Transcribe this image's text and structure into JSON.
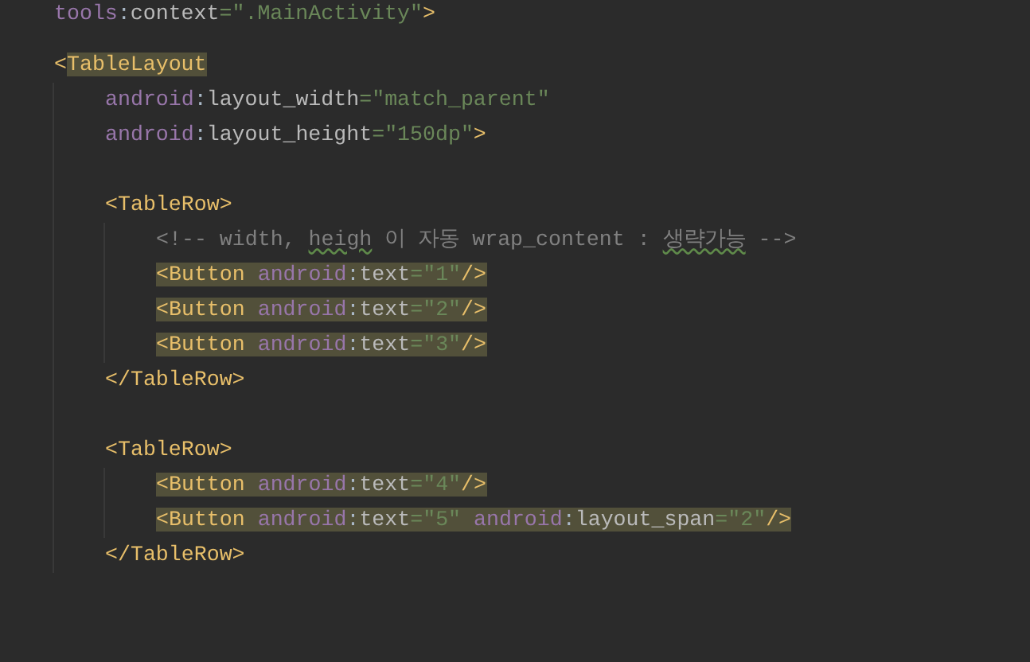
{
  "editor": {
    "lines": [
      {
        "kind": "code",
        "highlighted": false,
        "tokens": [
          {
            "kind": "ns",
            "text": "tools"
          },
          {
            "kind": "punct",
            "text": ":"
          },
          {
            "kind": "attr",
            "text": "context"
          },
          {
            "kind": "eq",
            "text": "="
          },
          {
            "kind": "string",
            "text": "\".MainActivity\""
          },
          {
            "kind": "tag",
            "text": ">"
          }
        ]
      },
      {
        "kind": "blank"
      },
      {
        "kind": "code",
        "highlighted": false,
        "tokens": [
          {
            "kind": "tag",
            "text": "<"
          },
          {
            "kind": "tag",
            "text": "TableLayout",
            "highlighted": true
          }
        ],
        "children": [
          {
            "kind": "code",
            "highlighted": false,
            "tokens": [
              {
                "kind": "ns",
                "text": "android"
              },
              {
                "kind": "punct",
                "text": ":"
              },
              {
                "kind": "attr",
                "text": "layout_width"
              },
              {
                "kind": "eq",
                "text": "="
              },
              {
                "kind": "string",
                "text": "\"match_parent\""
              }
            ]
          },
          {
            "kind": "code",
            "highlighted": false,
            "tokens": [
              {
                "kind": "ns",
                "text": "android"
              },
              {
                "kind": "punct",
                "text": ":"
              },
              {
                "kind": "attr",
                "text": "layout_height"
              },
              {
                "kind": "eq",
                "text": "="
              },
              {
                "kind": "string",
                "text": "\"150dp\""
              },
              {
                "kind": "tag",
                "text": ">"
              }
            ]
          },
          {
            "kind": "blank"
          },
          {
            "kind": "code",
            "highlighted": false,
            "tokens": [
              {
                "kind": "tag",
                "text": "<TableRow>"
              }
            ],
            "children": [
              {
                "kind": "code",
                "highlighted": false,
                "tokens": [
                  {
                    "kind": "comment",
                    "text": "<!-- width, "
                  },
                  {
                    "kind": "comment",
                    "text": "heigh",
                    "underlined": true
                  },
                  {
                    "kind": "comment",
                    "text": " 이 자동 wrap_content : "
                  },
                  {
                    "kind": "comment",
                    "text": "생략가능",
                    "underlined": true
                  },
                  {
                    "kind": "comment",
                    "text": " -->"
                  }
                ]
              },
              {
                "kind": "code",
                "highlighted": true,
                "tokens": [
                  {
                    "kind": "tag",
                    "text": "<Button "
                  },
                  {
                    "kind": "ns",
                    "text": "android"
                  },
                  {
                    "kind": "punct",
                    "text": ":"
                  },
                  {
                    "kind": "attr",
                    "text": "text"
                  },
                  {
                    "kind": "eq",
                    "text": "="
                  },
                  {
                    "kind": "string",
                    "text": "\"1\""
                  },
                  {
                    "kind": "tag",
                    "text": "/>"
                  }
                ]
              },
              {
                "kind": "code",
                "highlighted": true,
                "tokens": [
                  {
                    "kind": "tag",
                    "text": "<Button "
                  },
                  {
                    "kind": "ns",
                    "text": "android"
                  },
                  {
                    "kind": "punct",
                    "text": ":"
                  },
                  {
                    "kind": "attr",
                    "text": "text"
                  },
                  {
                    "kind": "eq",
                    "text": "="
                  },
                  {
                    "kind": "string",
                    "text": "\"2\""
                  },
                  {
                    "kind": "tag",
                    "text": "/>"
                  }
                ]
              },
              {
                "kind": "code",
                "highlighted": true,
                "tokens": [
                  {
                    "kind": "tag",
                    "text": "<Button "
                  },
                  {
                    "kind": "ns",
                    "text": "android"
                  },
                  {
                    "kind": "punct",
                    "text": ":"
                  },
                  {
                    "kind": "attr",
                    "text": "text"
                  },
                  {
                    "kind": "eq",
                    "text": "="
                  },
                  {
                    "kind": "string",
                    "text": "\"3\""
                  },
                  {
                    "kind": "tag",
                    "text": "/>"
                  }
                ]
              }
            ]
          },
          {
            "kind": "code",
            "highlighted": false,
            "tokens": [
              {
                "kind": "tag",
                "text": "</TableRow>"
              }
            ]
          },
          {
            "kind": "blank"
          },
          {
            "kind": "code",
            "highlighted": false,
            "tokens": [
              {
                "kind": "tag",
                "text": "<TableRow>"
              }
            ],
            "children": [
              {
                "kind": "code",
                "highlighted": true,
                "tokens": [
                  {
                    "kind": "tag",
                    "text": "<Button "
                  },
                  {
                    "kind": "ns",
                    "text": "android"
                  },
                  {
                    "kind": "punct",
                    "text": ":"
                  },
                  {
                    "kind": "attr",
                    "text": "text"
                  },
                  {
                    "kind": "eq",
                    "text": "="
                  },
                  {
                    "kind": "string",
                    "text": "\"4\""
                  },
                  {
                    "kind": "tag",
                    "text": "/>"
                  }
                ]
              },
              {
                "kind": "code",
                "highlighted": true,
                "tokens": [
                  {
                    "kind": "tag",
                    "text": "<Button "
                  },
                  {
                    "kind": "ns",
                    "text": "android"
                  },
                  {
                    "kind": "punct",
                    "text": ":"
                  },
                  {
                    "kind": "attr",
                    "text": "text"
                  },
                  {
                    "kind": "eq",
                    "text": "="
                  },
                  {
                    "kind": "string",
                    "text": "\"5\" "
                  },
                  {
                    "kind": "ns",
                    "text": "android"
                  },
                  {
                    "kind": "punct",
                    "text": ":"
                  },
                  {
                    "kind": "attr",
                    "text": "layout_span"
                  },
                  {
                    "kind": "eq",
                    "text": "="
                  },
                  {
                    "kind": "string",
                    "text": "\"2\""
                  },
                  {
                    "kind": "tag",
                    "text": "/>"
                  }
                ]
              }
            ]
          },
          {
            "kind": "code",
            "highlighted": false,
            "tokens": [
              {
                "kind": "tag",
                "text": "</TableRow>"
              }
            ]
          }
        ]
      }
    ]
  }
}
